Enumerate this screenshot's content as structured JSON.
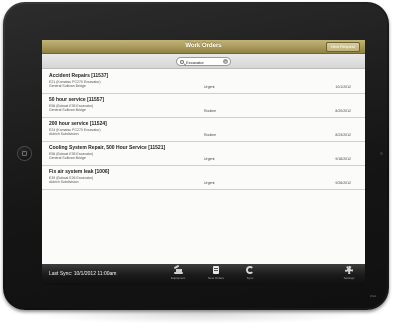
{
  "app": {
    "title": "Work Orders",
    "new_request_label": "New Request"
  },
  "search": {
    "value": "Excavator"
  },
  "work_orders": [
    {
      "title": "Accident Repairs [11537]",
      "equipment": "E21 (Komatsu PC270 Excavator)",
      "location": "General Sullivan Bridge",
      "priority": "Urgent",
      "date": "10/1/2012"
    },
    {
      "title": "50 hour service [11557]",
      "equipment": "E56 (Bobcat E35 Excavator)",
      "location": "General Sullivan Bridge",
      "priority": "Routine",
      "date": "8/20/2012"
    },
    {
      "title": "200 hour service [11524]",
      "equipment": "E24 (Komatsu PC270 Excavator)",
      "location": "Aldrich Subdivision",
      "priority": "Routine",
      "date": "8/23/2012"
    },
    {
      "title": "Cooling System Repair, 500 Hour Service [11521]",
      "equipment": "E56 (Bobcat E35 Excavator)",
      "location": "General Sullivan Bridge",
      "priority": "Urgent",
      "date": "9/18/2012"
    },
    {
      "title": "Fix air system leak [1006]",
      "equipment": "E39 (Bobcat E26 Excavator)",
      "location": "Aldrich Subdivision",
      "priority": "Urgent",
      "date": "9/26/2012"
    }
  ],
  "status": {
    "last_sync": "Last Sync: 10/1/2012 11:00am"
  },
  "tabs": [
    {
      "label": "Equipment",
      "icon": "excavator-icon"
    },
    {
      "label": "New Orders",
      "icon": "doc-icon"
    },
    {
      "label": "Sync",
      "icon": "sync-icon"
    },
    {
      "label": "Settings",
      "icon": "gear-icon"
    }
  ],
  "device": {
    "label": "iPad"
  },
  "colors": {
    "navbar": "#a99a5b",
    "tabbar": "#1b1b1b",
    "row_divider": "#d7d1a9",
    "screen_bg": "#fbfbf9"
  }
}
